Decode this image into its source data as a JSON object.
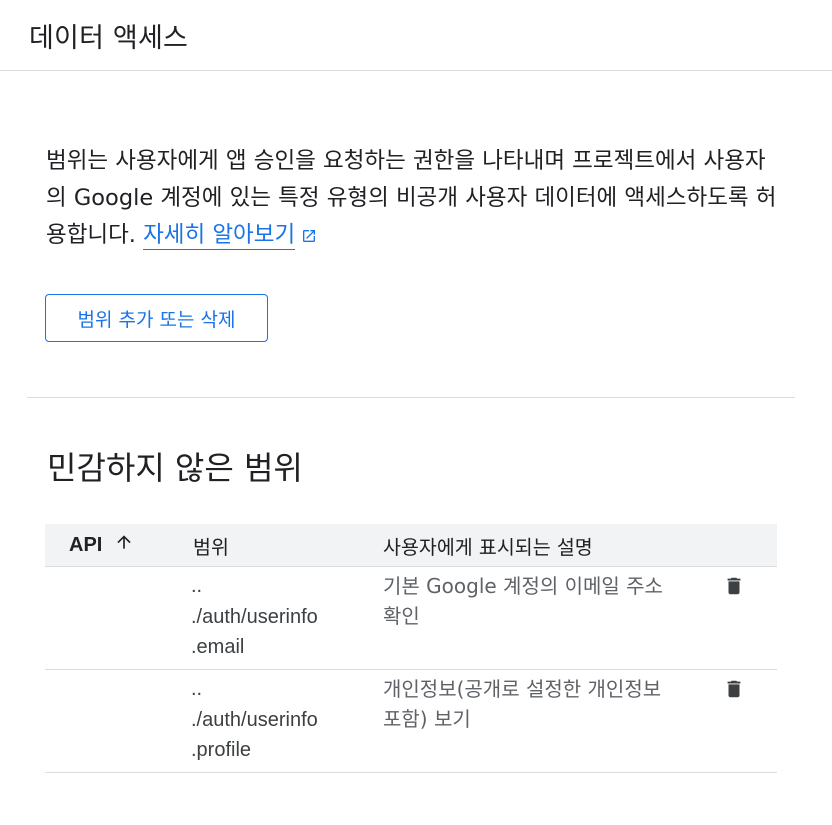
{
  "header": {
    "title": "데이터 액세스"
  },
  "intro": {
    "text": "범위는 사용자에게 앱 승인을 요청하는 권한을 나타내며 프로젝트에서 사용자의 Google 계정에 있는 특정 유형의 비공개 사용자 데이터에 액세스하도록 허용합니다. ",
    "learn_more_label": "자세히 알아보기",
    "external_icon": "open-in-new-icon"
  },
  "actions": {
    "add_remove_scopes_label": "범위 추가 또는 삭제"
  },
  "non_sensitive": {
    "title": "민감하지 않은 범위",
    "columns": {
      "api": "API",
      "scope": "범위",
      "user_facing_description": "사용자에게 표시되는 설명"
    },
    "sort": {
      "column": "API",
      "direction": "ascending",
      "icon": "arrow-upward-icon"
    },
    "rows": [
      {
        "api": "",
        "scope_lines": [
          "..",
          "./auth/userinfo",
          ".email"
        ],
        "description": "기본 Google 계정의 이메일 주소 확인",
        "delete_icon": "trash-icon"
      },
      {
        "api": "",
        "scope_lines": [
          "..",
          "./auth/userinfo",
          ".profile"
        ],
        "description": "개인정보(공개로 설정한 개인정보 포함) 보기",
        "delete_icon": "trash-icon"
      }
    ]
  },
  "colors": {
    "accent": "#1a73e8",
    "text_primary": "#202124",
    "text_secondary": "#5f6368",
    "header_bg": "#f1f3f4",
    "divider": "#dadce0"
  }
}
